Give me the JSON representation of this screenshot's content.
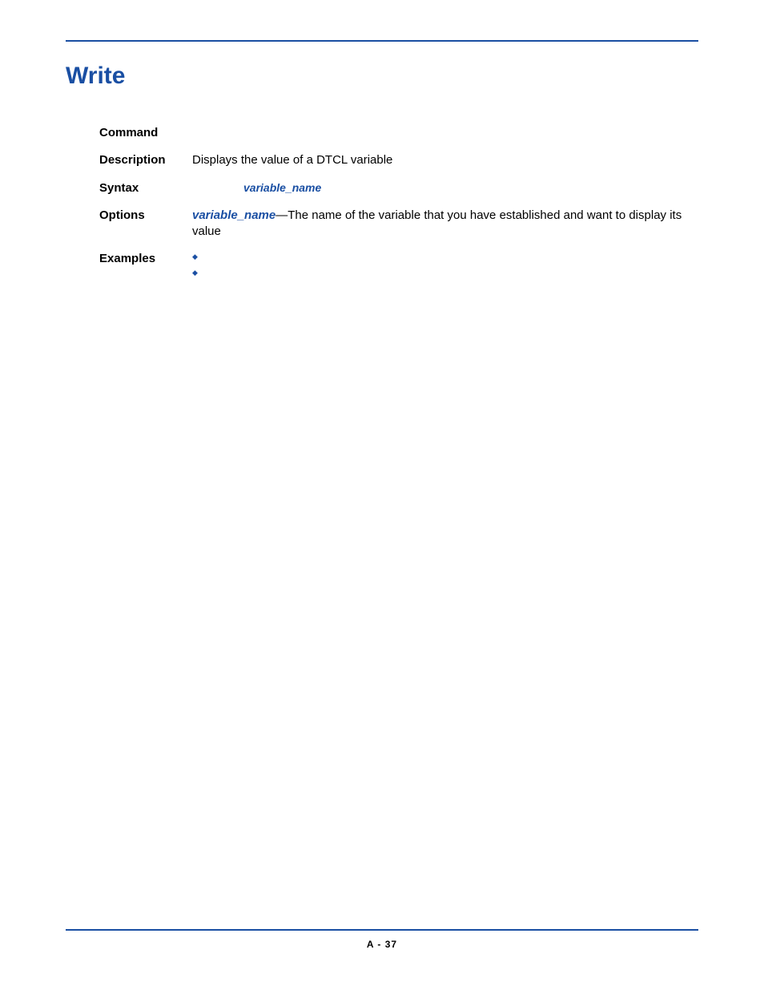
{
  "title": "Write",
  "definitions": {
    "command_label": "Command",
    "command_value": "",
    "description_label": "Description",
    "description_value": "Displays the value of a DTCL variable",
    "syntax_label": "Syntax",
    "syntax_value": "variable_name",
    "options_label": "Options",
    "options_param": "variable_name",
    "options_desc": "—The name of the variable that you have established and want to display its value",
    "examples_label": "Examples",
    "examples_items": [
      "",
      ""
    ]
  },
  "footer": "A - 37"
}
